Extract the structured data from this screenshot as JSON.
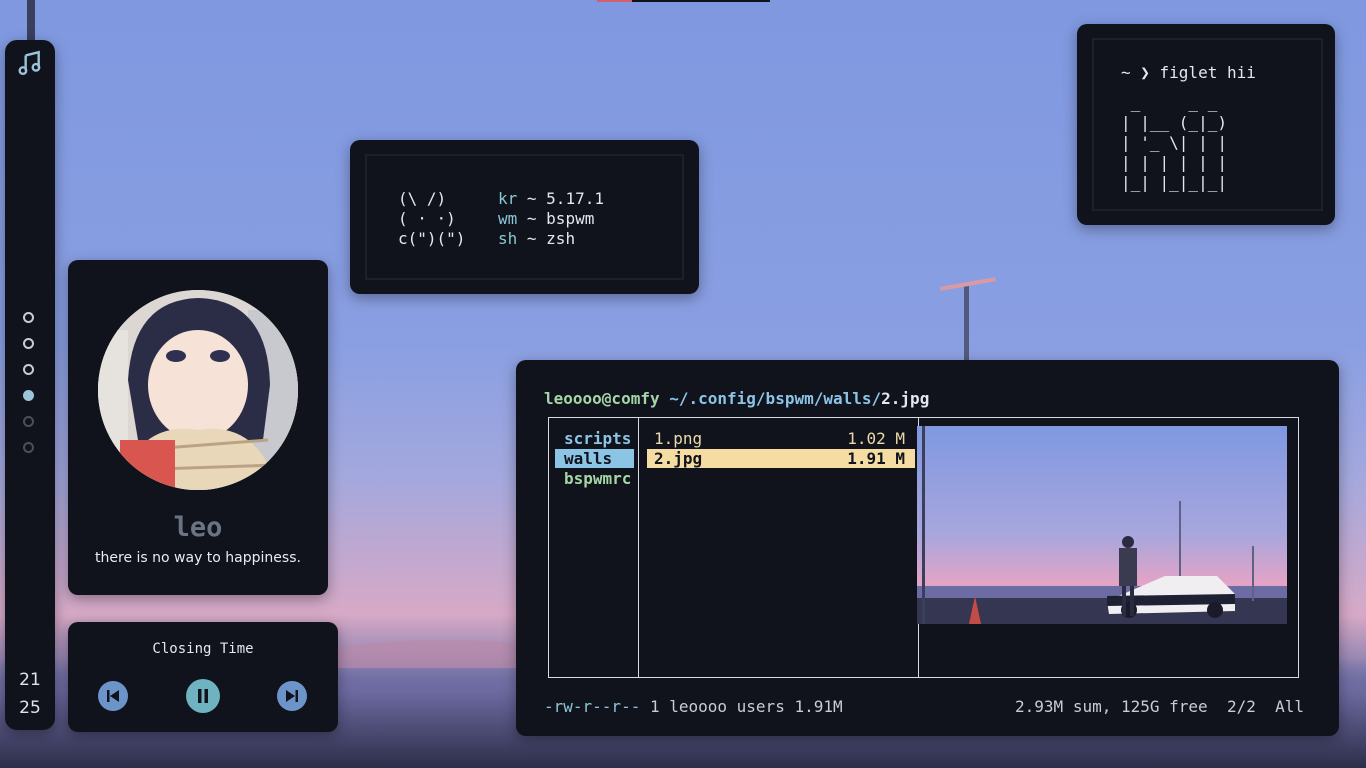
{
  "sidebar": {
    "workspaces": [
      {
        "state": "occupied"
      },
      {
        "state": "occupied"
      },
      {
        "state": "occupied"
      },
      {
        "state": "active"
      },
      {
        "state": "empty"
      },
      {
        "state": "empty"
      }
    ],
    "clock_hour": "21",
    "clock_minute": "25"
  },
  "profile": {
    "name": "leo",
    "quote": "there is no way to happiness."
  },
  "player": {
    "song_title": "Closing Time"
  },
  "fetch": {
    "art_line1": "(\\ /)",
    "art_line2": "( · ·)",
    "art_line3": "c(\")(\")",
    "kr_key": "kr",
    "kr_sep": " ~ ",
    "kr_val": "5.17.1",
    "wm_key": "wm",
    "wm_sep": " ~ ",
    "wm_val": "bspwm",
    "sh_key": "sh",
    "sh_sep": " ~ ",
    "sh_val": "zsh"
  },
  "figlet": {
    "prompt": "~ ❯ figlet hii",
    "art": [
      " _     _ _ ",
      "| |__ (_|_)",
      "| '_ \\| | |",
      "| | | | | |",
      "|_| |_|_|_|"
    ]
  },
  "ranger": {
    "user_host": "leoooo@comfy",
    "path": " ~/.config/bspwm/walls/",
    "file": "2.jpg",
    "dirs": [
      {
        "name": "scripts",
        "selected": false
      },
      {
        "name": "walls",
        "selected": true
      },
      {
        "name": "bspwmrc",
        "selected": false
      }
    ],
    "files": [
      {
        "name": "1.png",
        "size": "1.02 M",
        "selected": false
      },
      {
        "name": "2.jpg",
        "size": "1.91 M",
        "selected": true
      }
    ],
    "perms": "-rw-r--r--",
    "file_info": " 1 leoooo users 1.91M",
    "summary": "2.93M sum, 125G free  2/2  All"
  },
  "colors": {
    "panel": "#10131c",
    "teal": "#89c8d6",
    "blue": "#8cc4e6",
    "green": "#a5d6a7",
    "yellow": "#f5dca3"
  }
}
